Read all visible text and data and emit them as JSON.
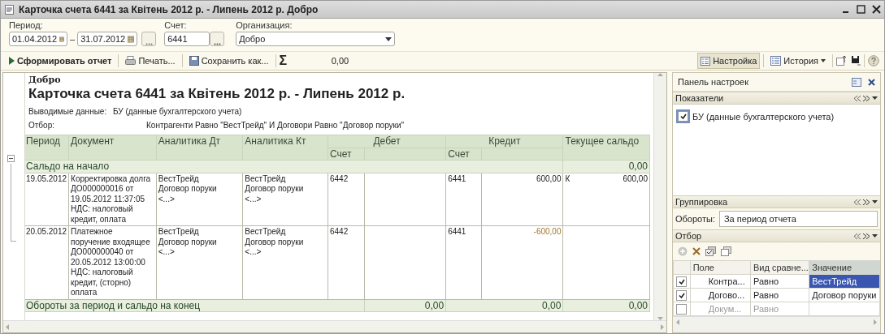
{
  "window": {
    "title": "Карточка счета 6441 за Квітень 2012 р. - Липень 2012 р. Добро"
  },
  "params": {
    "period_label": "Период:",
    "date_from": "01.04.2012",
    "separator": "–",
    "date_to": "31.07.2012",
    "account_label": "Счет:",
    "account": "6441",
    "organization_label": "Организация:",
    "organization": "Добро"
  },
  "toolbar": {
    "generate": "Сформировать отчет",
    "print": "Печать...",
    "save": "Сохранить как...",
    "sum_symbol": "Σ",
    "sum_value": "0,00",
    "settings": {
      "label": "Настройка",
      "selected": true
    },
    "history": "История"
  },
  "report": {
    "organization": "Добро",
    "title": "Карточка счета 6441 за Квітень 2012 р. - Липень 2012 р.",
    "output_label": "Выводимые данные:",
    "output_value": "БУ (данные бухгалтерского учета)",
    "filter_label": "Отбор:",
    "filter_value": "Контрагенти Равно \"ВестТрейд\" И Договори Равно \"Договор поруки\"",
    "table": {
      "columns": [
        "Период",
        "Документ",
        "Аналитика Дт",
        "Аналитика Кт"
      ],
      "debit_header": "Дебет",
      "credit_header": "Кредит",
      "balance_header": "Текущее сальдо",
      "debit_account_header": "Счет",
      "credit_account_header": "Счет",
      "opening": {
        "label": "Сальдо на начало",
        "balance": "0,00",
        "expanded": true
      },
      "rows": [
        {
          "period": "19.05.2012",
          "document": "Корректировка долга\nДО000000016 от\n19.05.2012 11:37:05\nНДС: налоговый\nкредит, оплата",
          "analytics_dt": "ВестТрейд\nДоговор поруки\n<...>",
          "analytics_kt": "ВестТрейд\nДоговор поруки\n<...>",
          "debit_account": "6442",
          "credit_account": "6441",
          "credit_amount": "600,00",
          "negative": false,
          "balance_side": "К",
          "balance": "600,00"
        },
        {
          "period": "20.05.2012",
          "document": "Платежное\nпоручение входящее\nДО000000040 от\n20.05.2012 13:00:00\nНДС: налоговый\nкредит, (сторно)\nоплата",
          "analytics_dt": "ВестТрейд\nДоговор поруки\n<...>",
          "analytics_kt": "ВестТрейд\nДоговор поруки\n<...>",
          "debit_account": "6442",
          "credit_account": "6441",
          "credit_amount": "-600,00",
          "negative": true
        }
      ],
      "closing": {
        "label": "Обороты за период и сальдо на конец",
        "debit": "0,00",
        "credit": "0,00",
        "balance": "0,00"
      }
    }
  },
  "settings_panel": {
    "title": "Панель настроек",
    "indicators": {
      "title": "Показатели",
      "items": [
        {
          "label": "БУ (данные бухгалтерского учета)",
          "checked": true
        }
      ]
    },
    "grouping": {
      "title": "Группировка",
      "label": "Обороты:",
      "value": "За период отчета"
    },
    "filter": {
      "title": "Отбор",
      "columns": [
        "Поле",
        "Вид сравне...",
        "Значение"
      ],
      "rows": [
        {
          "checked": true,
          "field": "Контра...",
          "comparison": "Равно",
          "value": "ВестТрейд",
          "selected": true
        },
        {
          "checked": true,
          "field": "Догово...",
          "comparison": "Равно",
          "value": "Договор поруки",
          "selected": false
        },
        {
          "checked": false,
          "field": "Докум...",
          "comparison": "Равно",
          "selected": false
        }
      ]
    }
  }
}
